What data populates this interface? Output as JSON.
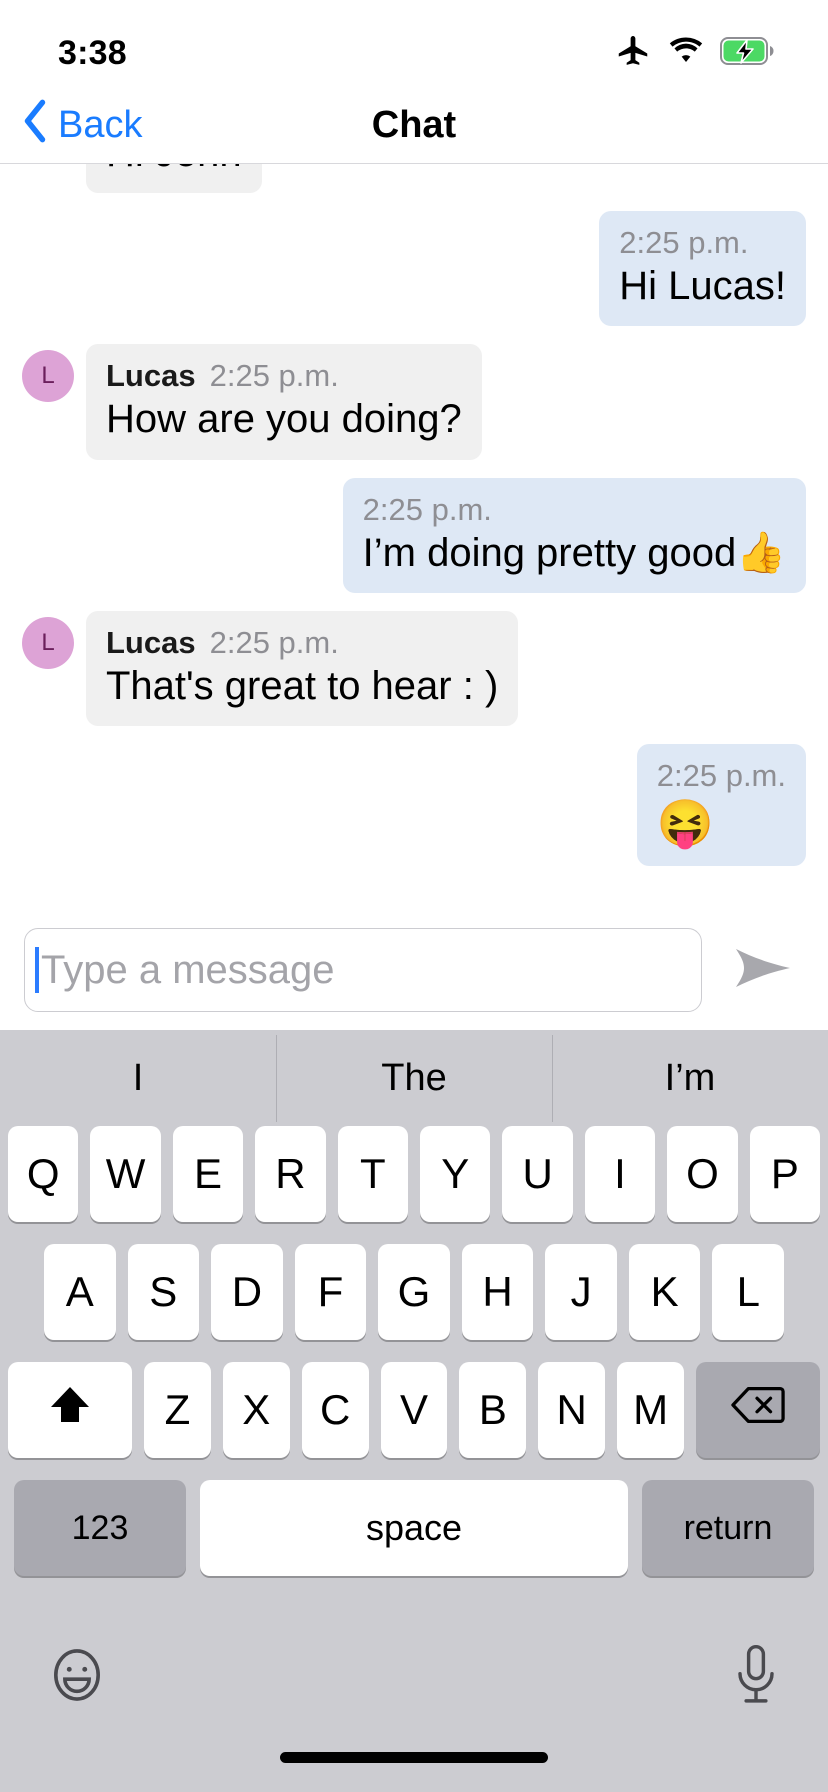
{
  "status_bar": {
    "time": "3:38",
    "icons": [
      "airplane-mode-icon",
      "wifi-icon",
      "battery-charging-icon"
    ],
    "battery_color": "#4cd964"
  },
  "nav_bar": {
    "back_label": "Back",
    "title": "Chat",
    "accent_color": "#1a7cff"
  },
  "conversation": {
    "messages": [
      {
        "id": "m1",
        "direction": "incoming",
        "sender": "",
        "time": "",
        "text": "Hi John",
        "show_avatar": false,
        "clipped": true
      },
      {
        "id": "m2",
        "direction": "outgoing",
        "sender": "",
        "time": "2:25 p.m.",
        "text": "Hi Lucas!",
        "show_avatar": false,
        "clipped": false
      },
      {
        "id": "m3",
        "direction": "incoming",
        "sender": "Lucas",
        "time": "2:25 p.m.",
        "text": "How are you doing?",
        "show_avatar": true,
        "avatar_initial": "L",
        "clipped": false
      },
      {
        "id": "m4",
        "direction": "outgoing",
        "sender": "",
        "time": "2:25 p.m.",
        "text": "I’m doing pretty good👍",
        "show_avatar": false,
        "clipped": false
      },
      {
        "id": "m5",
        "direction": "incoming",
        "sender": "Lucas",
        "time": "2:25 p.m.",
        "text": "That's great to hear : )",
        "show_avatar": true,
        "avatar_initial": "L",
        "clipped": false
      },
      {
        "id": "m6",
        "direction": "outgoing",
        "sender": "",
        "time": "2:25 p.m.",
        "text": "😝",
        "show_avatar": false,
        "emoji_only": true,
        "clipped": false
      }
    ],
    "bubble_color_incoming": "#f0f0f0",
    "bubble_color_outgoing": "#dee8f5",
    "avatar_color": "#dda3d6",
    "avatar_text_color": "#6b1f5c"
  },
  "composer": {
    "placeholder": "Type a message",
    "value": "",
    "send_icon": "send-arrow-icon",
    "caret_color": "#2b7cff"
  },
  "keyboard": {
    "predictions": [
      "I",
      "The",
      "I’m"
    ],
    "row1": [
      "Q",
      "W",
      "E",
      "R",
      "T",
      "Y",
      "U",
      "I",
      "O",
      "P"
    ],
    "row2": [
      "A",
      "S",
      "D",
      "F",
      "G",
      "H",
      "J",
      "K",
      "L"
    ],
    "row3": [
      "Z",
      "X",
      "C",
      "V",
      "B",
      "N",
      "M"
    ],
    "shift_icon": "shift-up-arrow-icon",
    "backspace_icon": "backspace-delete-icon",
    "numeric_label": "123",
    "space_label": "space",
    "return_label": "return",
    "emoji_icon": "emoji-smiley-icon",
    "dictation_icon": "microphone-icon",
    "background_color": "#ccccd1",
    "key_color": "#ffffff",
    "func_key_color": "#a9a9b0"
  },
  "home_indicator": {
    "visible": true
  }
}
